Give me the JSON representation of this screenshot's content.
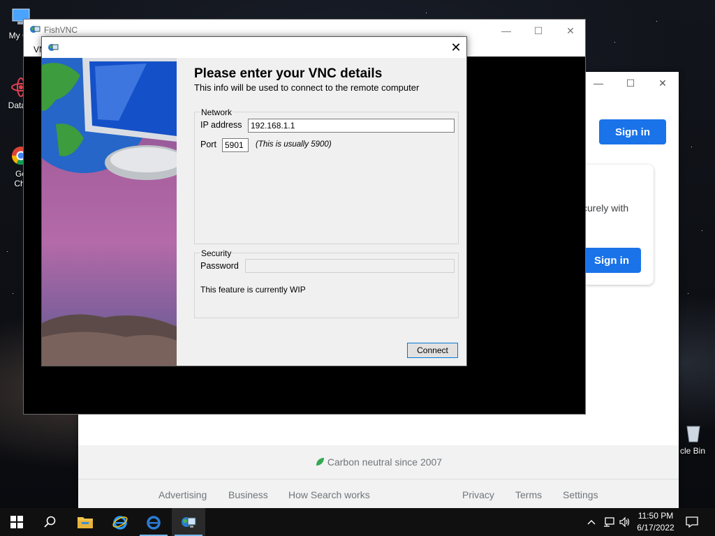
{
  "desktop": {
    "icons": [
      {
        "label": "My Co"
      },
      {
        "label": "DataW"
      },
      {
        "label": "Go"
      },
      {
        "label": "Chr"
      },
      {
        "label": "cle Bin"
      }
    ]
  },
  "browser": {
    "sign_in_top": "Sign in",
    "card_text": "curely with",
    "sign_in_card": "Sign in",
    "carbon": "Carbon neutral since 2007",
    "footer_left": [
      "Advertising",
      "Business",
      "How Search works"
    ],
    "footer_right": [
      "Privacy",
      "Terms",
      "Settings"
    ]
  },
  "fishvnc": {
    "title": "FishVNC",
    "menu_fragment": "VN"
  },
  "dialog": {
    "heading": "Please enter your VNC details",
    "subheading": "This info will be used to connect to the remote computer",
    "network": {
      "legend": "Network",
      "ip_label": "IP address",
      "ip_value": "192.168.1.1",
      "port_label": "Port",
      "port_value": "5901",
      "port_hint": "(This is usually 5900)"
    },
    "security": {
      "legend": "Security",
      "password_label": "Password",
      "password_value": "",
      "wip_note": "This feature is currently WIP"
    },
    "connect_label": "Connect"
  },
  "taskbar": {
    "time": "11:50 PM",
    "date": "6/17/2022"
  },
  "colors": {
    "google_blue": "#1a73e8",
    "focus_blue": "#0078d7",
    "taskbar": "#101010"
  }
}
